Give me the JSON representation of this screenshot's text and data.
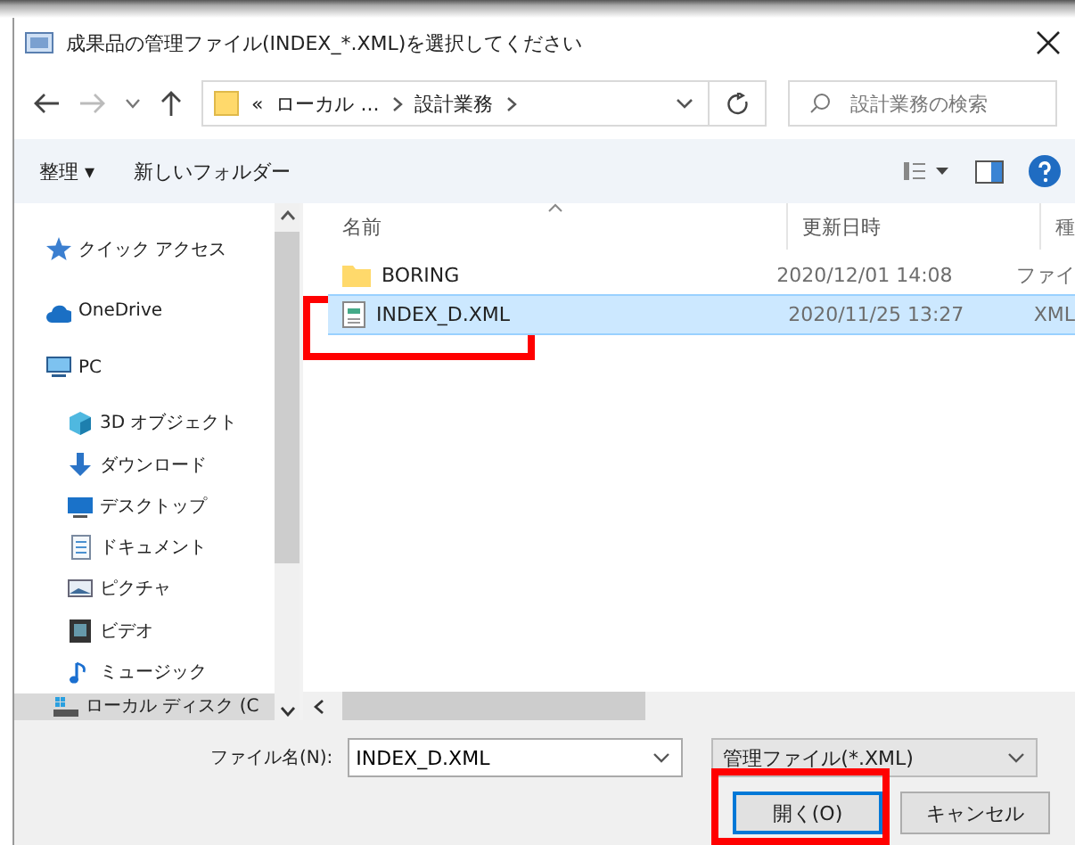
{
  "window": {
    "title": "成果品の管理ファイル(INDEX_*.XML)を選択してください"
  },
  "address": {
    "overflow": "«",
    "crumbs": [
      "ローカル ...",
      "設計業務"
    ]
  },
  "search": {
    "placeholder": "設計業務の検索"
  },
  "toolbar": {
    "organize": "整理 ▾",
    "new_folder": "新しいフォルダー"
  },
  "sidebar": {
    "items": [
      {
        "label": "クイック アクセス",
        "kind": "star",
        "selected": false
      },
      {
        "label": "OneDrive",
        "kind": "cloud",
        "selected": false
      },
      {
        "label": "PC",
        "kind": "pc",
        "selected": false,
        "children": [
          {
            "label": "3D オブジェクト",
            "kind": "cube",
            "selected": false
          },
          {
            "label": "ダウンロード",
            "kind": "download",
            "selected": false
          },
          {
            "label": "デスクトップ",
            "kind": "desktop",
            "selected": false
          },
          {
            "label": "ドキュメント",
            "kind": "document",
            "selected": false
          },
          {
            "label": "ピクチャ",
            "kind": "pictures",
            "selected": false
          },
          {
            "label": "ビデオ",
            "kind": "video",
            "selected": false
          },
          {
            "label": "ミュージック",
            "kind": "music",
            "selected": false
          },
          {
            "label": "ローカル ディスク (C",
            "kind": "disk",
            "selected": true
          }
        ]
      }
    ]
  },
  "table": {
    "columns": [
      "名前",
      "更新日時",
      "種"
    ],
    "rows": [
      {
        "kind": "folder",
        "cells": [
          "BORING",
          "2020/12/01 14:08",
          "ファイ"
        ],
        "selected": false,
        "highlighted": false
      },
      {
        "kind": "xml",
        "cells": [
          "INDEX_D.XML",
          "2020/11/25 13:27",
          "XML"
        ],
        "selected": true,
        "highlighted": true
      }
    ]
  },
  "filename": {
    "label": "ファイル名(N):",
    "value": "INDEX_D.XML"
  },
  "filter": {
    "value": "管理ファイル(*.XML)"
  },
  "buttons": [
    {
      "label": "開く(O)",
      "kind": "open",
      "highlighted": true
    },
    {
      "label": "キャンセル",
      "kind": "cancel",
      "highlighted": false
    }
  ]
}
